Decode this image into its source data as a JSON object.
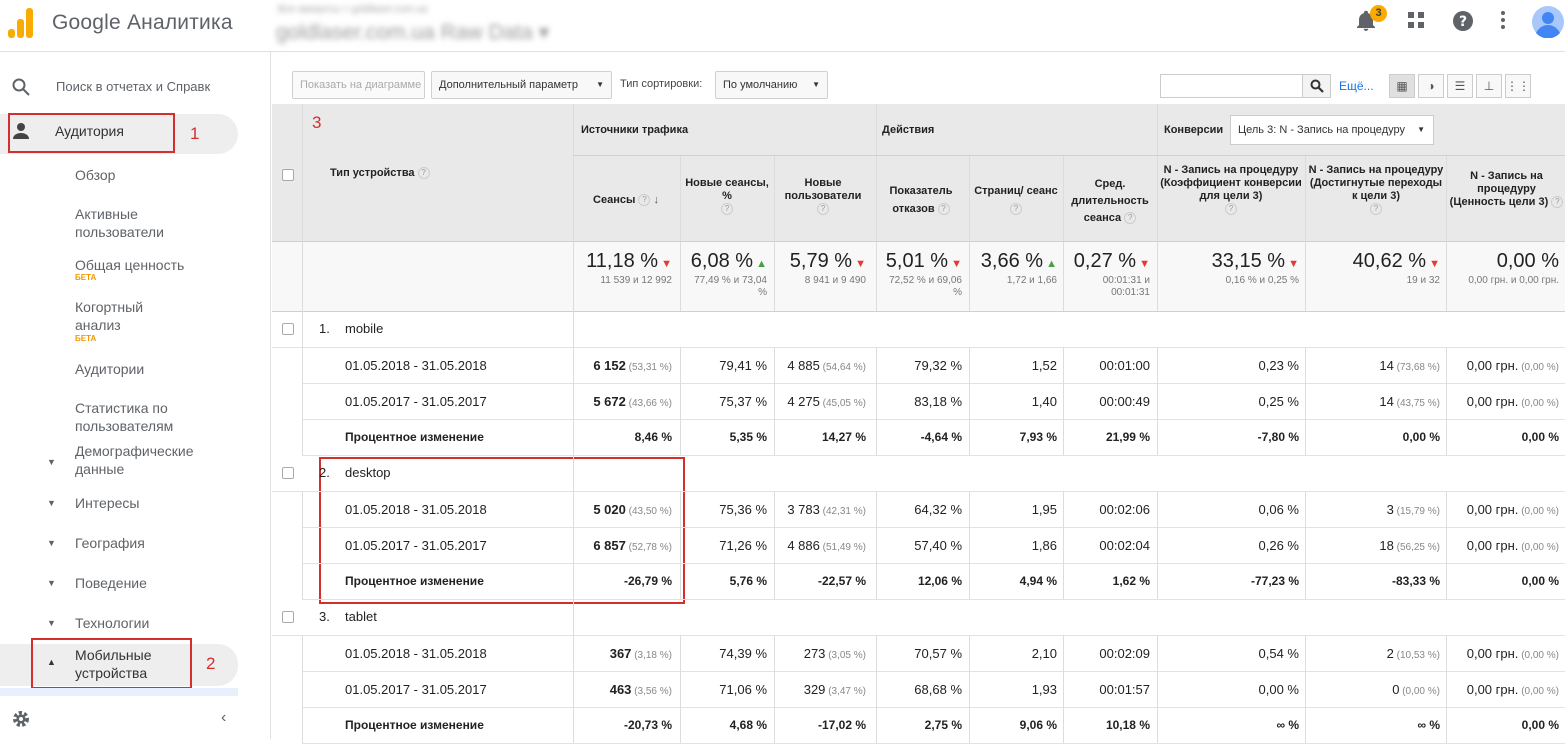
{
  "header": {
    "brand": "Google Аналитика",
    "account_path": "Все аккаунты > goldlaser.com.ua",
    "view_name": "goldlaser.com.ua Raw Data",
    "notification_count": "3"
  },
  "sidebar": {
    "search_placeholder": "Поиск в отчетах и Справк",
    "audience": "Аудитория",
    "items": {
      "overview": "Обзор",
      "active_users": "Активные пользователи",
      "lifetime_value": "Общая ценность",
      "lifetime_beta": "БЕТА",
      "cohort": "Когортный анализ",
      "cohort_beta": "БЕТА",
      "audiences": "Аудитории",
      "user_explorer": "Статистика по пользователям",
      "demographics": "Демографические данные",
      "interests": "Интересы",
      "geo": "География",
      "behavior": "Поведение",
      "technology": "Технологии",
      "mobile": "Мобильные устройства"
    },
    "annotations": [
      "1",
      "2"
    ]
  },
  "toolbar": {
    "plot_rows": "Показать на диаграмме",
    "secondary_dim": "Дополнительный параметр",
    "sort_label": "Тип сортировки:",
    "sort_value": "По умолчанию",
    "more": "Ещё..."
  },
  "table": {
    "annotation": "3",
    "dim_header": "Тип устройства",
    "groups": {
      "acquisition": "Источники трафика",
      "behavior": "Действия",
      "conversions": "Конверсии",
      "goal_select": "Цель 3: N - Запись на процедуру"
    },
    "columns": {
      "sessions": "Сеансы",
      "new_sessions": "Новые сеансы, %",
      "new_users": "Новые пользователи",
      "bounce": "Показатель отказов",
      "pages": "Страниц/ сеанс",
      "duration": "Сред. длительность сеанса",
      "conv_rate": "N - Запись на процедуру (Коэффициент конверсии для цели 3)",
      "completions": "N - Запись на процедуру (Достигнутые переходы к цели 3)",
      "value": "N - Запись на процедуру (Ценность цели 3)"
    },
    "totals": [
      {
        "main": "11,18 %",
        "dir": "down",
        "sub": "11 539 и 12 992"
      },
      {
        "main": "6,08 %",
        "dir": "up",
        "sub": "77,49 % и 73,04 %"
      },
      {
        "main": "5,79 %",
        "dir": "down",
        "sub": "8 941 и 9 490"
      },
      {
        "main": "5,01 %",
        "dir": "down",
        "sub": "72,52 % и 69,06 %"
      },
      {
        "main": "3,66 %",
        "dir": "up",
        "sub": "1,72 и 1,66"
      },
      {
        "main": "0,27 %",
        "dir": "down",
        "sub": "00:01:31 и 00:01:31"
      },
      {
        "main": "33,15 %",
        "dir": "down",
        "sub": "0,16 % и 0,25 %"
      },
      {
        "main": "40,62 %",
        "dir": "down",
        "sub": "19 и 32"
      },
      {
        "main": "0,00 %",
        "dir": "",
        "sub": "0,00 грн. и 0,00 грн."
      }
    ],
    "rows": [
      {
        "num": "1.",
        "device": "mobile",
        "lines": [
          {
            "label": "01.05.2018 - 31.05.2018",
            "cells": [
              [
                "6 152",
                "(53,31 %)"
              ],
              [
                "79,41 %",
                ""
              ],
              [
                "4 885",
                "(54,64 %)"
              ],
              [
                "79,32 %",
                ""
              ],
              [
                "1,52",
                ""
              ],
              [
                "00:01:00",
                ""
              ],
              [
                "0,23 %",
                ""
              ],
              [
                "14",
                "(73,68 %)"
              ],
              [
                "0,00 грн.",
                "(0,00 %)"
              ]
            ]
          },
          {
            "label": "01.05.2017 - 31.05.2017",
            "cells": [
              [
                "5 672",
                "(43,66 %)"
              ],
              [
                "75,37 %",
                ""
              ],
              [
                "4 275",
                "(45,05 %)"
              ],
              [
                "83,18 %",
                ""
              ],
              [
                "1,40",
                ""
              ],
              [
                "00:00:49",
                ""
              ],
              [
                "0,25 %",
                ""
              ],
              [
                "14",
                "(43,75 %)"
              ],
              [
                "0,00 грн.",
                "(0,00 %)"
              ]
            ]
          },
          {
            "label": "Процентное изменение",
            "cells": [
              [
                "8,46 %",
                ""
              ],
              [
                "5,35 %",
                ""
              ],
              [
                "14,27 %",
                ""
              ],
              [
                "-4,64 %",
                ""
              ],
              [
                "7,93 %",
                ""
              ],
              [
                "21,99 %",
                ""
              ],
              [
                "-7,80 %",
                ""
              ],
              [
                "0,00 %",
                ""
              ],
              [
                "0,00 %",
                ""
              ]
            ]
          }
        ]
      },
      {
        "num": "2.",
        "device": "desktop",
        "lines": [
          {
            "label": "01.05.2018 - 31.05.2018",
            "cells": [
              [
                "5 020",
                "(43,50 %)"
              ],
              [
                "75,36 %",
                ""
              ],
              [
                "3 783",
                "(42,31 %)"
              ],
              [
                "64,32 %",
                ""
              ],
              [
                "1,95",
                ""
              ],
              [
                "00:02:06",
                ""
              ],
              [
                "0,06 %",
                ""
              ],
              [
                "3",
                "(15,79 %)"
              ],
              [
                "0,00 грн.",
                "(0,00 %)"
              ]
            ]
          },
          {
            "label": "01.05.2017 - 31.05.2017",
            "cells": [
              [
                "6 857",
                "(52,78 %)"
              ],
              [
                "71,26 %",
                ""
              ],
              [
                "4 886",
                "(51,49 %)"
              ],
              [
                "57,40 %",
                ""
              ],
              [
                "1,86",
                ""
              ],
              [
                "00:02:04",
                ""
              ],
              [
                "0,26 %",
                ""
              ],
              [
                "18",
                "(56,25 %)"
              ],
              [
                "0,00 грн.",
                "(0,00 %)"
              ]
            ]
          },
          {
            "label": "Процентное изменение",
            "cells": [
              [
                "-26,79 %",
                ""
              ],
              [
                "5,76 %",
                ""
              ],
              [
                "-22,57 %",
                ""
              ],
              [
                "12,06 %",
                ""
              ],
              [
                "4,94 %",
                ""
              ],
              [
                "1,62 %",
                ""
              ],
              [
                "-77,23 %",
                ""
              ],
              [
                "-83,33 %",
                ""
              ],
              [
                "0,00 %",
                ""
              ]
            ]
          }
        ]
      },
      {
        "num": "3.",
        "device": "tablet",
        "lines": [
          {
            "label": "01.05.2018 - 31.05.2018",
            "cells": [
              [
                "367",
                "(3,18 %)"
              ],
              [
                "74,39 %",
                ""
              ],
              [
                "273",
                "(3,05 %)"
              ],
              [
                "70,57 %",
                ""
              ],
              [
                "2,10",
                ""
              ],
              [
                "00:02:09",
                ""
              ],
              [
                "0,54 %",
                ""
              ],
              [
                "2",
                "(10,53 %)"
              ],
              [
                "0,00 грн.",
                "(0,00 %)"
              ]
            ]
          },
          {
            "label": "01.05.2017 - 31.05.2017",
            "cells": [
              [
                "463",
                "(3,56 %)"
              ],
              [
                "71,06 %",
                ""
              ],
              [
                "329",
                "(3,47 %)"
              ],
              [
                "68,68 %",
                ""
              ],
              [
                "1,93",
                ""
              ],
              [
                "00:01:57",
                ""
              ],
              [
                "0,00 %",
                ""
              ],
              [
                "0",
                "(0,00 %)"
              ],
              [
                "0,00 грн.",
                "(0,00 %)"
              ]
            ]
          },
          {
            "label": "Процентное изменение",
            "cells": [
              [
                "-20,73 %",
                ""
              ],
              [
                "4,68 %",
                ""
              ],
              [
                "-17,02 %",
                ""
              ],
              [
                "2,75 %",
                ""
              ],
              [
                "9,06 %",
                ""
              ],
              [
                "10,18 %",
                ""
              ],
              [
                "∞ %",
                ""
              ],
              [
                "∞ %",
                ""
              ],
              [
                "0,00 %",
                ""
              ]
            ]
          }
        ]
      }
    ]
  }
}
